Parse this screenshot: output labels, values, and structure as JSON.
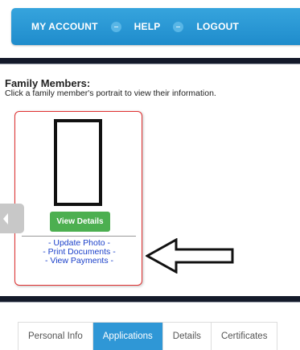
{
  "nav": {
    "my_account": "MY ACCOUNT",
    "help": "HELP",
    "logout": "LOGOUT"
  },
  "family": {
    "title": "Family Members:",
    "subtitle": "Click a family member's portrait to view their information."
  },
  "card": {
    "view_details": "View Details",
    "links": [
      "- Update Photo -",
      "- Print Documents -",
      "- View Payments -"
    ]
  },
  "tabs": [
    {
      "label": "Personal Info",
      "active": false
    },
    {
      "label": "Applications",
      "active": true
    },
    {
      "label": "Details",
      "active": false
    },
    {
      "label": "Certificates",
      "active": false
    }
  ],
  "colors": {
    "nav_blue": "#1f8ccc",
    "dark_bar": "#141a2a",
    "card_border": "#e03030",
    "button_green": "#4caf50",
    "link_blue": "#1a3fc9",
    "tab_active": "#2f97d6"
  }
}
